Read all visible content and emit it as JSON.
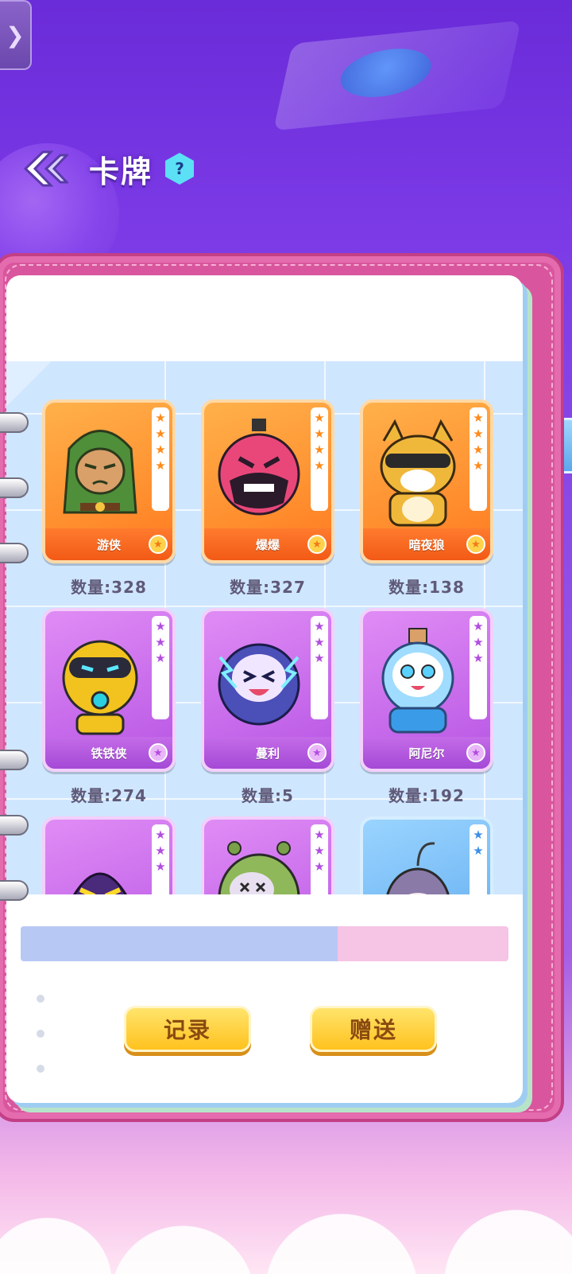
{
  "header": {
    "title": "卡牌",
    "help_label": "?",
    "side_tab_glyph": "❯"
  },
  "cards": [
    {
      "name": "游侠",
      "quantity": "数量:328",
      "rarity": "orange",
      "stars": 4,
      "icon": "ranger-character"
    },
    {
      "name": "爆爆",
      "quantity": "数量:327",
      "rarity": "orange",
      "stars": 4,
      "icon": "bomb-character"
    },
    {
      "name": "暗夜狼",
      "quantity": "数量:138",
      "rarity": "orange",
      "stars": 4,
      "icon": "raccoon-character"
    },
    {
      "name": "铁铁侠",
      "quantity": "数量:274",
      "rarity": "purple",
      "stars": 3,
      "icon": "robot-character"
    },
    {
      "name": "蔓利",
      "quantity": "数量:5",
      "rarity": "purple",
      "stars": 3,
      "icon": "thunder-character"
    },
    {
      "name": "阿尼尔",
      "quantity": "数量:192",
      "rarity": "purple",
      "stars": 3,
      "icon": "bottle-character"
    },
    {
      "name": "",
      "quantity": "",
      "rarity": "purple",
      "stars": 3,
      "icon": "hooded-character"
    },
    {
      "name": "",
      "quantity": "",
      "rarity": "purple",
      "stars": 3,
      "icon": "zombie-character"
    },
    {
      "name": "",
      "quantity": "",
      "rarity": "blue",
      "stars": 2,
      "icon": "sprout-character"
    }
  ],
  "buttons": {
    "record": "记录",
    "gift": "赠送"
  },
  "colors": {
    "background_top": "#6a2bd8",
    "notebook": "#d9569e",
    "button_yellow": "#ffc21f",
    "orange_card": "#ff7a1f",
    "purple_card": "#b654e4",
    "blue_card": "#5aa7ee"
  }
}
